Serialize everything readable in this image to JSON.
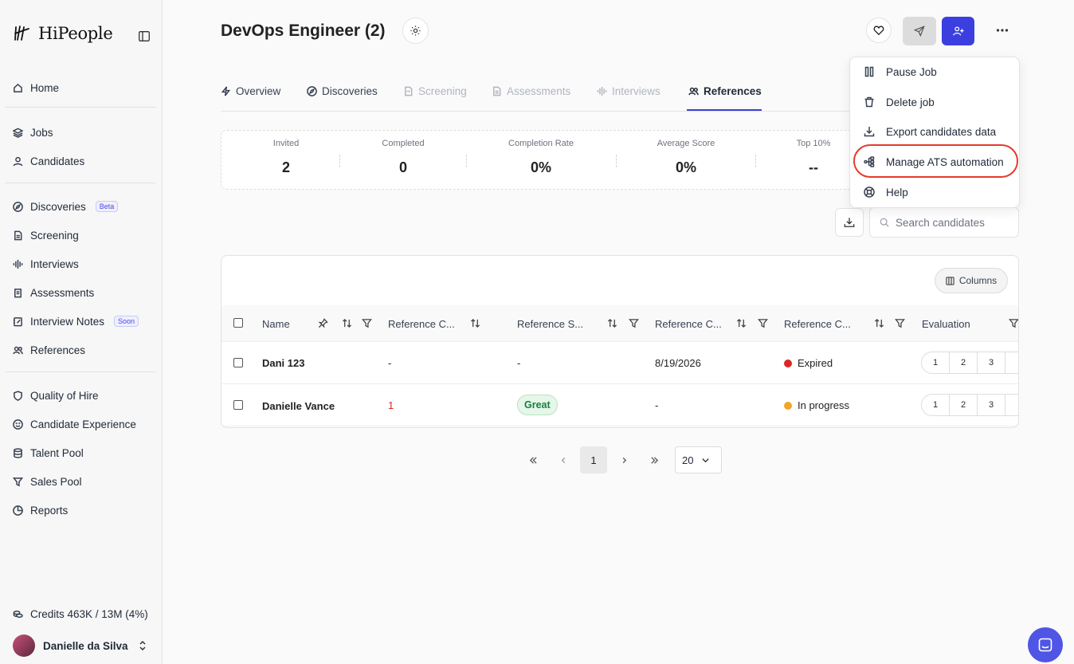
{
  "app": {
    "brand": "HiPeople",
    "accent": "#3b3fd8"
  },
  "sidebar": {
    "items": [
      {
        "label": "Home",
        "icon": "home-icon"
      },
      {
        "label": "Jobs",
        "icon": "layers-icon"
      },
      {
        "label": "Candidates",
        "icon": "user-icon"
      },
      {
        "label": "Discoveries",
        "icon": "compass-icon",
        "badge": "Beta"
      },
      {
        "label": "Screening",
        "icon": "file-icon"
      },
      {
        "label": "Interviews",
        "icon": "waveform-icon"
      },
      {
        "label": "Assessments",
        "icon": "clipboard-icon"
      },
      {
        "label": "Interview Notes",
        "icon": "notes-icon",
        "badge": "Soon"
      },
      {
        "label": "References",
        "icon": "users-icon"
      },
      {
        "label": "Quality of Hire",
        "icon": "shield-icon"
      },
      {
        "label": "Candidate Experience",
        "icon": "smile-icon"
      },
      {
        "label": "Talent Pool",
        "icon": "database-icon"
      },
      {
        "label": "Sales Pool",
        "icon": "filter-icon"
      },
      {
        "label": "Reports",
        "icon": "pie-icon"
      }
    ],
    "credits": "Credits 463K / 13M (4%)",
    "user": "Danielle da Silva"
  },
  "header": {
    "title": "DevOps Engineer (2)"
  },
  "tabs": [
    {
      "label": "Overview",
      "state": "enabled"
    },
    {
      "label": "Discoveries",
      "state": "enabled"
    },
    {
      "label": "Screening",
      "state": "disabled"
    },
    {
      "label": "Assessments",
      "state": "disabled"
    },
    {
      "label": "Interviews",
      "state": "disabled"
    },
    {
      "label": "References",
      "state": "active"
    }
  ],
  "stats": [
    {
      "label": "Invited",
      "value": "2"
    },
    {
      "label": "Completed",
      "value": "0"
    },
    {
      "label": "Completion Rate",
      "value": "0%"
    },
    {
      "label": "Average Score",
      "value": "0%"
    },
    {
      "label": "Top 10%",
      "value": "--"
    }
  ],
  "search": {
    "placeholder": "Search candidates"
  },
  "table": {
    "columns_button": "Columns",
    "headers": [
      "Name",
      "Reference C...",
      "Reference S...",
      "Reference C...",
      "Reference C...",
      "Evaluation"
    ],
    "rows": [
      {
        "name": "Dani 123",
        "ref_count": "-",
        "ref_score": "-",
        "ref_date": "8/19/2026",
        "status": "Expired",
        "status_color": "#dc2626",
        "eval": [
          "1",
          "2",
          "3"
        ]
      },
      {
        "name": "Danielle Vance",
        "ref_count": "1",
        "ref_score": "Great",
        "ref_date": "-",
        "status": "In progress",
        "status_color": "#f5a524",
        "eval": [
          "1",
          "2",
          "3"
        ]
      }
    ]
  },
  "pagination": {
    "current": "1",
    "page_size": "20"
  },
  "menu": {
    "items": [
      {
        "label": "Pause Job",
        "icon": "pause-icon"
      },
      {
        "label": "Delete job",
        "icon": "trash-icon"
      },
      {
        "label": "Export candidates data",
        "icon": "download-icon"
      },
      {
        "label": "Manage ATS automation",
        "icon": "workflow-icon",
        "highlighted": true
      },
      {
        "label": "Help",
        "icon": "lifebuoy-icon"
      }
    ]
  }
}
